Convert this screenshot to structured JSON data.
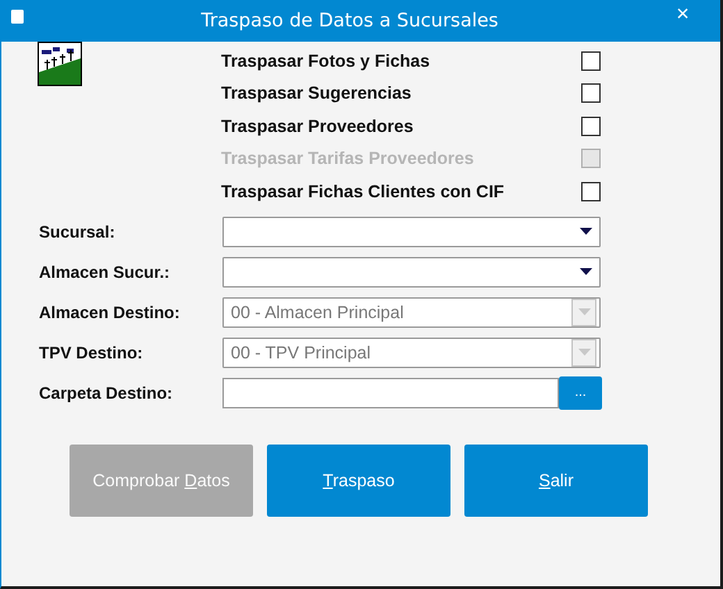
{
  "window": {
    "title": "Traspaso de Datos a Sucursales",
    "close": "×"
  },
  "options": [
    {
      "label": "Traspasar Fotos y Fichas",
      "checked": false,
      "disabled": false
    },
    {
      "label": "Traspasar Sugerencias",
      "checked": false,
      "disabled": false
    },
    {
      "label": "Traspasar Proveedores",
      "checked": false,
      "disabled": false
    },
    {
      "label": "Traspasar Tarifas Proveedores",
      "checked": false,
      "disabled": true
    },
    {
      "label": "Traspasar Fichas Clientes con CIF",
      "checked": false,
      "disabled": false
    }
  ],
  "fields": [
    {
      "kind": "combo",
      "label": "Sucursal:",
      "disabled": false
    },
    {
      "kind": "combo",
      "label": "Almacen Sucur.:",
      "disabled": false
    },
    {
      "kind": "combo",
      "label": "Almacen Destino:",
      "value": "00 - Almacen Principal",
      "disabled": true
    },
    {
      "kind": "combo",
      "label": "TPV Destino:",
      "value": "00 - TPV Principal",
      "disabled": true
    },
    {
      "kind": "folder",
      "label": "Carpeta Destino:",
      "button": "..."
    }
  ],
  "buttons": [
    {
      "before": "Comprobar ",
      "access_key": "D",
      "after": "atos",
      "disabled": true
    },
    {
      "access_key": "T",
      "after": "raspaso",
      "disabled": false
    },
    {
      "access_key": "S",
      "after": "alir",
      "disabled": false
    }
  ]
}
